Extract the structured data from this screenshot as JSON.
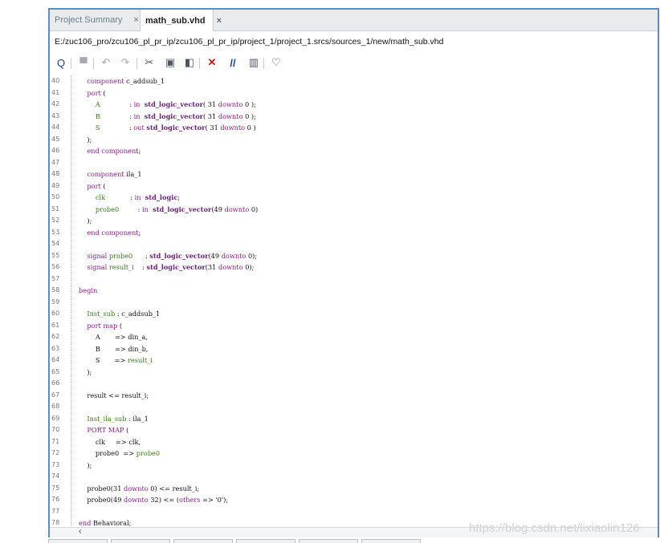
{
  "tabs": [
    {
      "label": "Project Summary",
      "close": "×"
    },
    {
      "label": "math_sub.vhd",
      "close": "×"
    }
  ],
  "file_path": "E:/zuc106_pro/zcu106_pl_pr_ip/zcu106_pl_pr_ip/project_1/project_1.srcs/sources_1/new/math_sub.vhd",
  "toolbar": {
    "icons": [
      "search-icon",
      "save-icon",
      "undo-icon",
      "redo-icon",
      "cut-icon",
      "copy-icon",
      "paste-icon",
      "delete-icon",
      "comment-icon",
      "block-icon",
      "lightbulb-icon"
    ],
    "glyphs": [
      "Q",
      "▀",
      "↶",
      "↷",
      "✂",
      "▣",
      "◧",
      "✕",
      "//",
      "▥",
      "♡"
    ]
  },
  "code_lines": [
    {
      "n": "40",
      "t": "    component c_addsub_1"
    },
    {
      "n": "41",
      "t": "    port ("
    },
    {
      "n": "42",
      "t": "        A              : in  std_logic_vector( 31 downto 0 );"
    },
    {
      "n": "43",
      "t": "        B              : in  std_logic_vector( 31 downto 0 );"
    },
    {
      "n": "44",
      "t": "        S              : out std_logic_vector( 31 downto 0 )"
    },
    {
      "n": "45",
      "t": "    );"
    },
    {
      "n": "46",
      "t": "    end component;"
    },
    {
      "n": "47",
      "t": ""
    },
    {
      "n": "48",
      "t": "    component ila_1"
    },
    {
      "n": "49",
      "t": "    port ("
    },
    {
      "n": "50",
      "t": "        clk            : in  std_logic;"
    },
    {
      "n": "51",
      "t": "        probe0         : in  std_logic_vector(49 downto 0)"
    },
    {
      "n": "52",
      "t": "    );"
    },
    {
      "n": "53",
      "t": "    end component;"
    },
    {
      "n": "54",
      "t": ""
    },
    {
      "n": "55",
      "t": "    signal probe0      : std_logic_vector(49 downto 0);"
    },
    {
      "n": "56",
      "t": "    signal result_i    : std_logic_vector(31 downto 0);"
    },
    {
      "n": "57",
      "t": ""
    },
    {
      "n": "58",
      "t": "begin"
    },
    {
      "n": "59",
      "t": ""
    },
    {
      "n": "60",
      "t": "    Inst_sub : c_addsub_1"
    },
    {
      "n": "61",
      "t": "    port map ("
    },
    {
      "n": "62",
      "t": "        A       => din_a,"
    },
    {
      "n": "63",
      "t": "        B       => din_b,"
    },
    {
      "n": "64",
      "t": "        S       => result_i"
    },
    {
      "n": "65",
      "t": "    );"
    },
    {
      "n": "66",
      "t": ""
    },
    {
      "n": "67",
      "t": "    result <= result_i;"
    },
    {
      "n": "68",
      "t": ""
    },
    {
      "n": "69",
      "t": "    Inst_ila_sub : ila_1"
    },
    {
      "n": "70",
      "t": "    PORT MAP ("
    },
    {
      "n": "71",
      "t": "        clk     => clk,"
    },
    {
      "n": "72",
      "t": "        probe0  => probe0"
    },
    {
      "n": "73",
      "t": "    );"
    },
    {
      "n": "74",
      "t": ""
    },
    {
      "n": "75",
      "t": "    probe0(31 downto 0) <= result_i;"
    },
    {
      "n": "76",
      "t": "    probe0(49 downto 32) <= (others => '0');"
    },
    {
      "n": "77",
      "t": ""
    },
    {
      "n": "78",
      "t": "end Behavioral;"
    }
  ],
  "scroll_left_glyph": "‹",
  "watermark": "https://blog.csdn.net/lixiaolin126"
}
